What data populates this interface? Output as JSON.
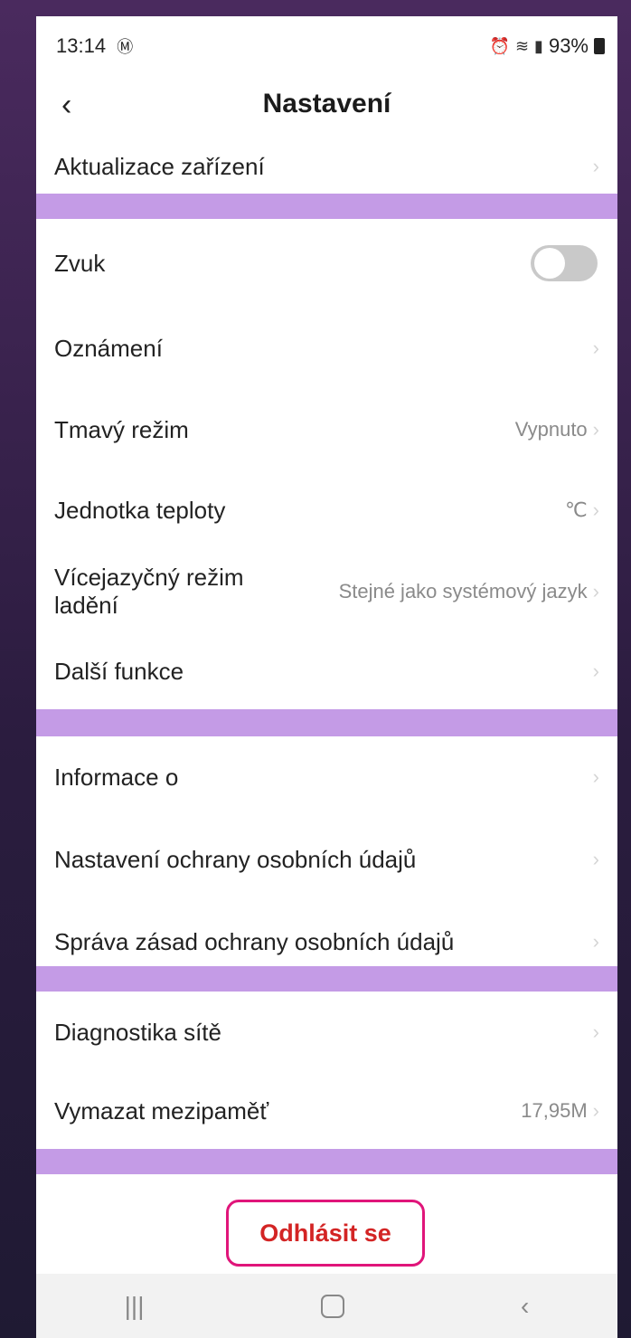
{
  "status_bar": {
    "time": "13:14",
    "mail_icon": "Ⓜ",
    "battery": "93%"
  },
  "header": {
    "back_icon": "‹",
    "title": "Nastavení"
  },
  "rows": {
    "device_update": {
      "label": "Aktualizace zařízení"
    },
    "sound": {
      "label": "Zvuk",
      "toggle_on": false
    },
    "notifications": {
      "label": "Oznámení"
    },
    "dark_mode": {
      "label": "Tmavý režim",
      "value": "Vypnuto"
    },
    "temp_unit": {
      "label": "Jednotka teploty",
      "value": "℃"
    },
    "multilang": {
      "label_line1": "Vícejazyčný režim",
      "label_line2": "ladění",
      "value": "Stejné jako systémový jazyk"
    },
    "more_functions": {
      "label": "Další funkce"
    },
    "about": {
      "label": "Informace o"
    },
    "privacy_settings": {
      "label": "Nastavení ochrany osobních údajů"
    },
    "privacy_policy": {
      "label": "Správa zásad ochrany osobních údajů"
    },
    "network_diagnostics": {
      "label": "Diagnostika sítě"
    },
    "clear_cache": {
      "label": "Vymazat mezipaměť",
      "value": "17,95M"
    }
  },
  "logout": {
    "label": "Odhlásit se"
  },
  "chevron": "›",
  "nav": {
    "recents": "|||",
    "back": "‹"
  },
  "colors": {
    "divider": "#c49be6",
    "logout_border": "#e0157a",
    "logout_text": "#d32424"
  }
}
